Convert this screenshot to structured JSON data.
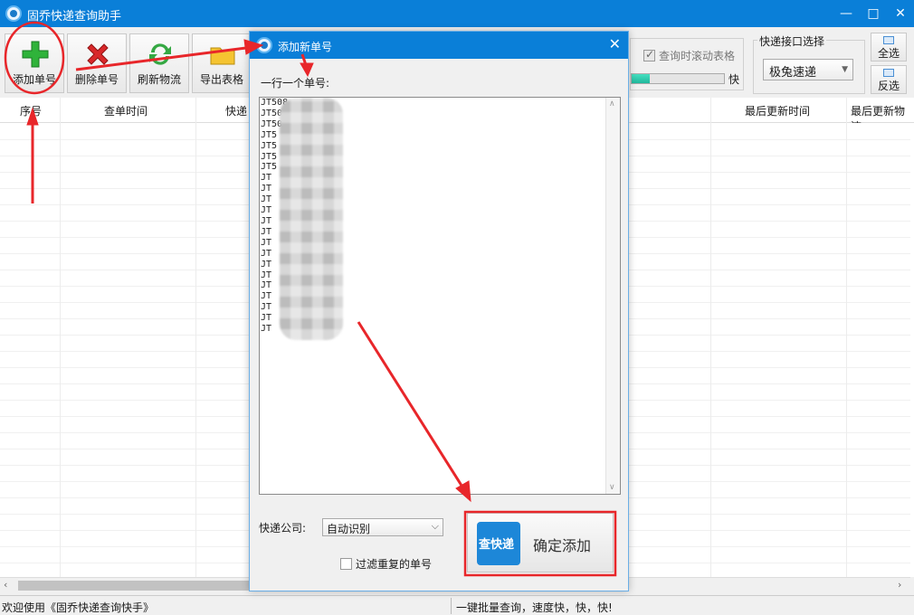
{
  "window": {
    "title": "固乔快递查询助手",
    "min": "—",
    "max": "□",
    "close": "✕"
  },
  "toolbar": {
    "buttons": [
      {
        "label": "添加单号"
      },
      {
        "label": "删除单号"
      },
      {
        "label": "刷新物流"
      },
      {
        "label": "导出表格"
      }
    ],
    "scroll_option": {
      "label": "查询时滚动表格",
      "checked": true
    },
    "speed": {
      "label": "快",
      "fill_fraction": 0.2
    },
    "api_group": {
      "title": "快递接口选择",
      "selected": "极兔速递"
    },
    "select_all": "全选",
    "invert_select": "反选"
  },
  "table": {
    "columns": [
      "序号",
      "查单时间",
      "快递",
      "最后更新时间",
      "最后更新物流"
    ]
  },
  "statusbar": {
    "left": "欢迎使用《固乔快递查询快手》",
    "right": "一键批量查询，速度快，快，快!"
  },
  "dialog": {
    "title": "添加新单号",
    "close": "✕",
    "instruction": "一行一个单号:",
    "numbers": [
      "JT508",
      "JT50",
      "JT50",
      "JT5",
      "JT5",
      "JT5",
      "JT5",
      "JT",
      "JT",
      "JT",
      "JT",
      "JT",
      "JT",
      "JT",
      "JT",
      "JT",
      "JT",
      "JT",
      "JT",
      "JT",
      "JT",
      "JT"
    ],
    "company_label": "快递公司:",
    "company_value": "自动识别",
    "filter_label": "过滤重复的单号",
    "filter_checked": false,
    "confirm_icon_text": "查快递",
    "confirm_label": "确定添加"
  },
  "colors": {
    "title_bar": "#0a7fd8",
    "annotation": "#e8262a",
    "speed_fill": "#20b89c"
  }
}
